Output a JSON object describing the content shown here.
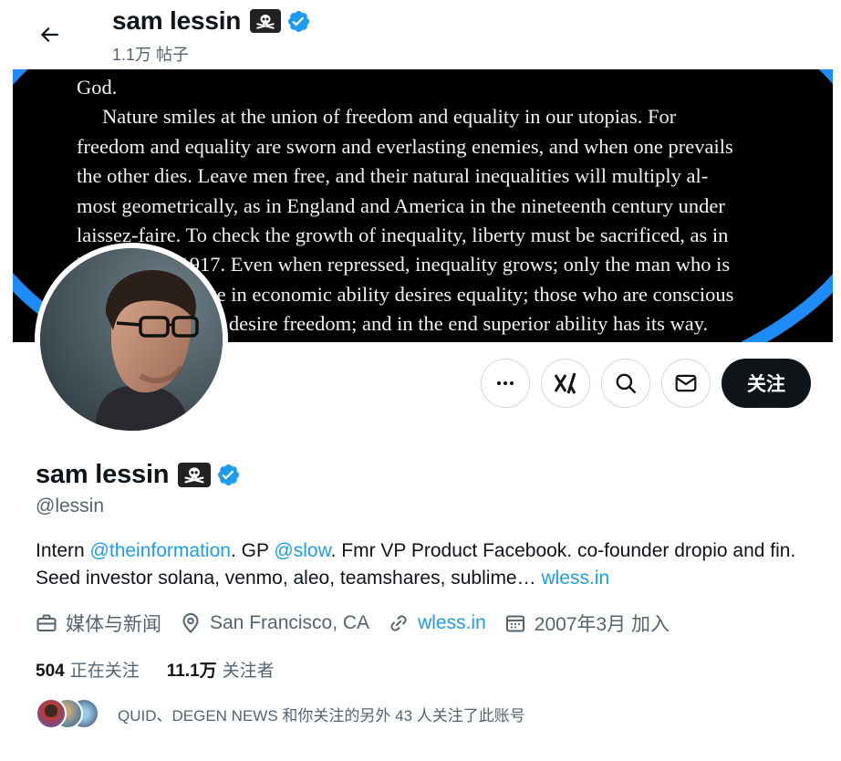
{
  "header": {
    "name": "sam lessin",
    "name_emoji": "☠",
    "posts_count": "1.1万 帖子"
  },
  "banner": {
    "lines": [
      "God.",
      "Nature smiles at the union of freedom and equality in our utopias. For",
      "freedom and equality are sworn and everlasting enemies, and when one prevails",
      "the other dies. Leave men free, and their natural inequalities will multiply al-",
      "most geometrically, as in England and America in the nineteenth century under",
      "laissez-faire. To check the growth of inequality, liberty must be sacrificed, as in",
      "Russia after 1917. Even when repressed, inequality grows; only the man who is",
      "below the average in economic ability desires equality; those who are conscious",
      "of superior ability desire freedom; and in the end superior ability has its way."
    ]
  },
  "actions": {
    "follow_label": "关注"
  },
  "profile": {
    "name": "sam lessin",
    "name_emoji": "☠",
    "handle": "@lessin",
    "bio": {
      "t1": "Intern ",
      "m1": "@theinformation",
      "t2": ". GP ",
      "m2": "@slow",
      "t3": ". Fmr VP Product Facebook. co-founder dropio and fin. Seed investor solana, venmo, aleo, teamshares, sublime… ",
      "l1": "wless.in"
    },
    "category": "媒体与新闻",
    "location": "San Francisco, CA",
    "website": "wless.in",
    "joined": "2007年3月 加入"
  },
  "stats": {
    "following_count": "504",
    "following_label": "正在关注",
    "followers_count": "11.1万",
    "followers_label": "关注者"
  },
  "followed_by": {
    "text": "QUID、DEGEN NEWS 和你关注的另外 43 人关注了此账号"
  },
  "colors": {
    "accent": "#1d9bf0",
    "text": "#0f1419",
    "muted": "#536471",
    "banner_ring": "#1d8cf8"
  }
}
